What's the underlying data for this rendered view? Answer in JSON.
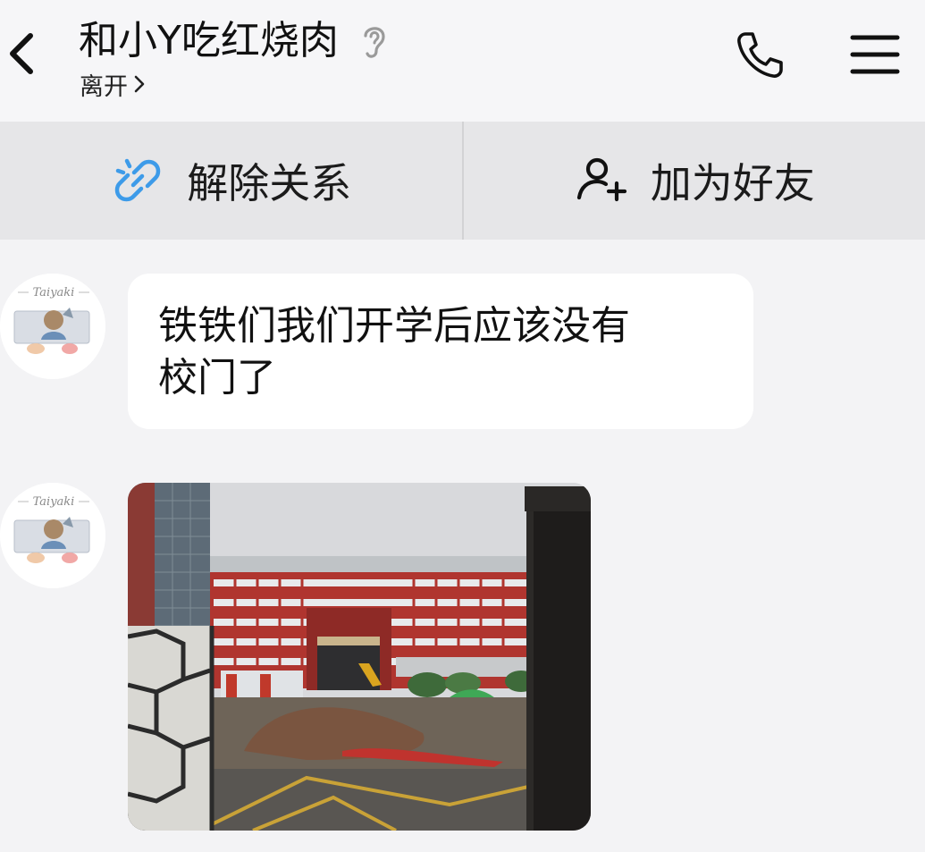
{
  "header": {
    "title": "和小Y吃红烧肉",
    "subtitle": "离开",
    "back_icon": "chevron-left-icon",
    "ear_icon": "ear-icon",
    "phone_icon": "phone-icon",
    "menu_icon": "menu-icon"
  },
  "actions": {
    "unlink_label": "解除关系",
    "unlink_icon": "broken-link-icon",
    "add_friend_label": "加为好友",
    "add_friend_icon": "add-user-icon"
  },
  "messages": [
    {
      "type": "text",
      "avatar_text": "Taiyaki",
      "line1": "铁铁们我们开学后应该没有",
      "line2": "校门了"
    },
    {
      "type": "image",
      "avatar_text": "Taiyaki"
    }
  ],
  "colors": {
    "background": "#f3f3f5",
    "action_bar": "#e6e6e8",
    "accent_blue": "#3d9be9"
  }
}
